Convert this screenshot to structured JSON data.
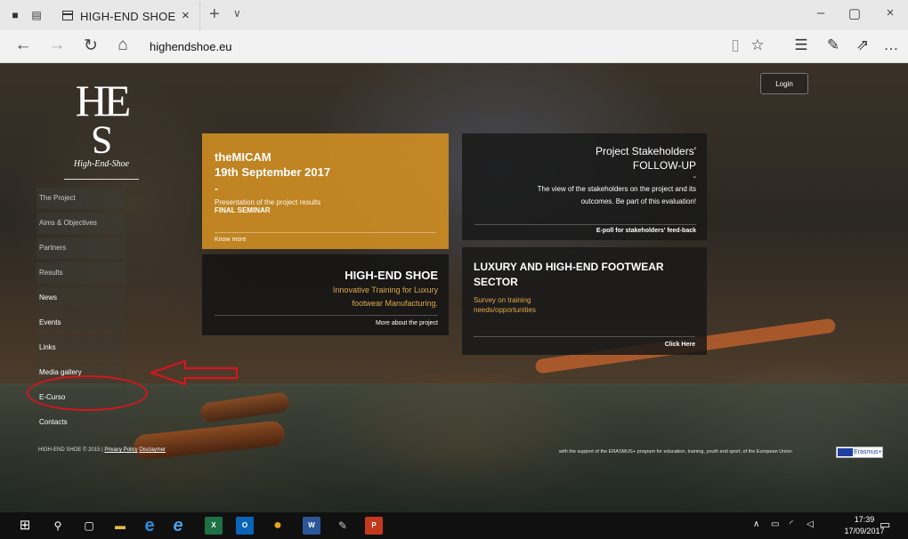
{
  "browser": {
    "tab_title": "HIGH-END SHOE",
    "tab_close": "×",
    "new_tab": "+",
    "tab_menu": "∨",
    "window_controls": {
      "minimize": "–",
      "restore": "▢",
      "close": "×"
    },
    "nav": {
      "back": "←",
      "forward": "→",
      "refresh": "↻",
      "home": "⌂"
    },
    "url": "highendshoe.eu",
    "toolbar_icons": [
      "reading-view-icon",
      "favorite-star-icon",
      "favorites-hub-icon",
      "web-note-icon",
      "share-icon",
      "more-icon"
    ],
    "toolbar_glyphs": {
      "reading": "▯",
      "star": "☆",
      "hub": "☰",
      "note": "✎",
      "share": "⇗",
      "more": "…"
    }
  },
  "site": {
    "logo": {
      "letters": "HE",
      "letter_s": "S",
      "name": "High-End-Shoe"
    },
    "login_label": "Login",
    "menu": [
      {
        "label": "The Project"
      },
      {
        "label": "Aims & Objectives"
      },
      {
        "label": "Partners"
      },
      {
        "label": "Results"
      },
      {
        "label": "News"
      },
      {
        "label": "Events"
      },
      {
        "label": "Links"
      },
      {
        "label": "Media gallery"
      },
      {
        "label": "E-Curso"
      },
      {
        "label": "Contacts"
      }
    ],
    "footer": {
      "copyright": "HIGH-END SHOE © 2015 |",
      "privacy": "Privacy Policy",
      "disclaimer": "Disclaymer"
    },
    "cards": {
      "micam": {
        "title_line1": "theMICAM",
        "title_line2": "19th September 2017",
        "dash": "-",
        "text": "Presentation of the project results",
        "text_bold": "FINAL SEMINAR",
        "link": "Know more"
      },
      "stakeholders": {
        "title_line1": "Project Stakeholders'",
        "title_line2": "FOLLOW-UP",
        "dash": "-",
        "text_line1": "The view of the stakeholders on the project and its",
        "text_line2": "outcomes. Be part of this evaluation!",
        "link": "E-poll for stakeholders' feed-back"
      },
      "highend": {
        "title": "HIGH-END SHOE",
        "text_line1": "Innovative Training for Luxury",
        "text_line2": "footwear Manufacturing.",
        "link": "More about the project"
      },
      "luxury": {
        "title_line1": "LUXURY AND HIGH-END FOOTWEAR",
        "title_line2": "SECTOR",
        "text_line1": "Survey on training",
        "text_line2": "needs/opportunities",
        "link": "Click Here"
      }
    },
    "erasmus_text": "with the support of the ERASMUS+ program for education, training, youth and sport, of the European Union",
    "erasmus_logo": "Erasmus+"
  },
  "taskbar": {
    "apps": [
      "start-icon",
      "search-icon",
      "task-view-icon",
      "file-explorer-icon",
      "edge-icon",
      "internet-explorer-icon",
      "excel-icon",
      "outlook-icon",
      "chrome-icon",
      "word-icon",
      "paint-icon",
      "powerpoint-icon"
    ],
    "glyphs": {
      "start": "⊞",
      "search": "⚲",
      "taskview": "▢",
      "explorer": "▬",
      "edge": "e",
      "ie": "e",
      "excel": "X",
      "outlook": "O",
      "chrome": "●",
      "word": "W",
      "paint": "✎",
      "ppt": "P"
    },
    "tray": {
      "chevron": "∧",
      "battery": "▭",
      "wifi": "◜",
      "volume": "◁"
    },
    "time": "17:39",
    "date": "17/09/2017",
    "notifications": "▭"
  },
  "colors": {
    "accent_gold": "#cd8c23",
    "annotation_red": "#d9141e",
    "taskbar": "#101010"
  }
}
